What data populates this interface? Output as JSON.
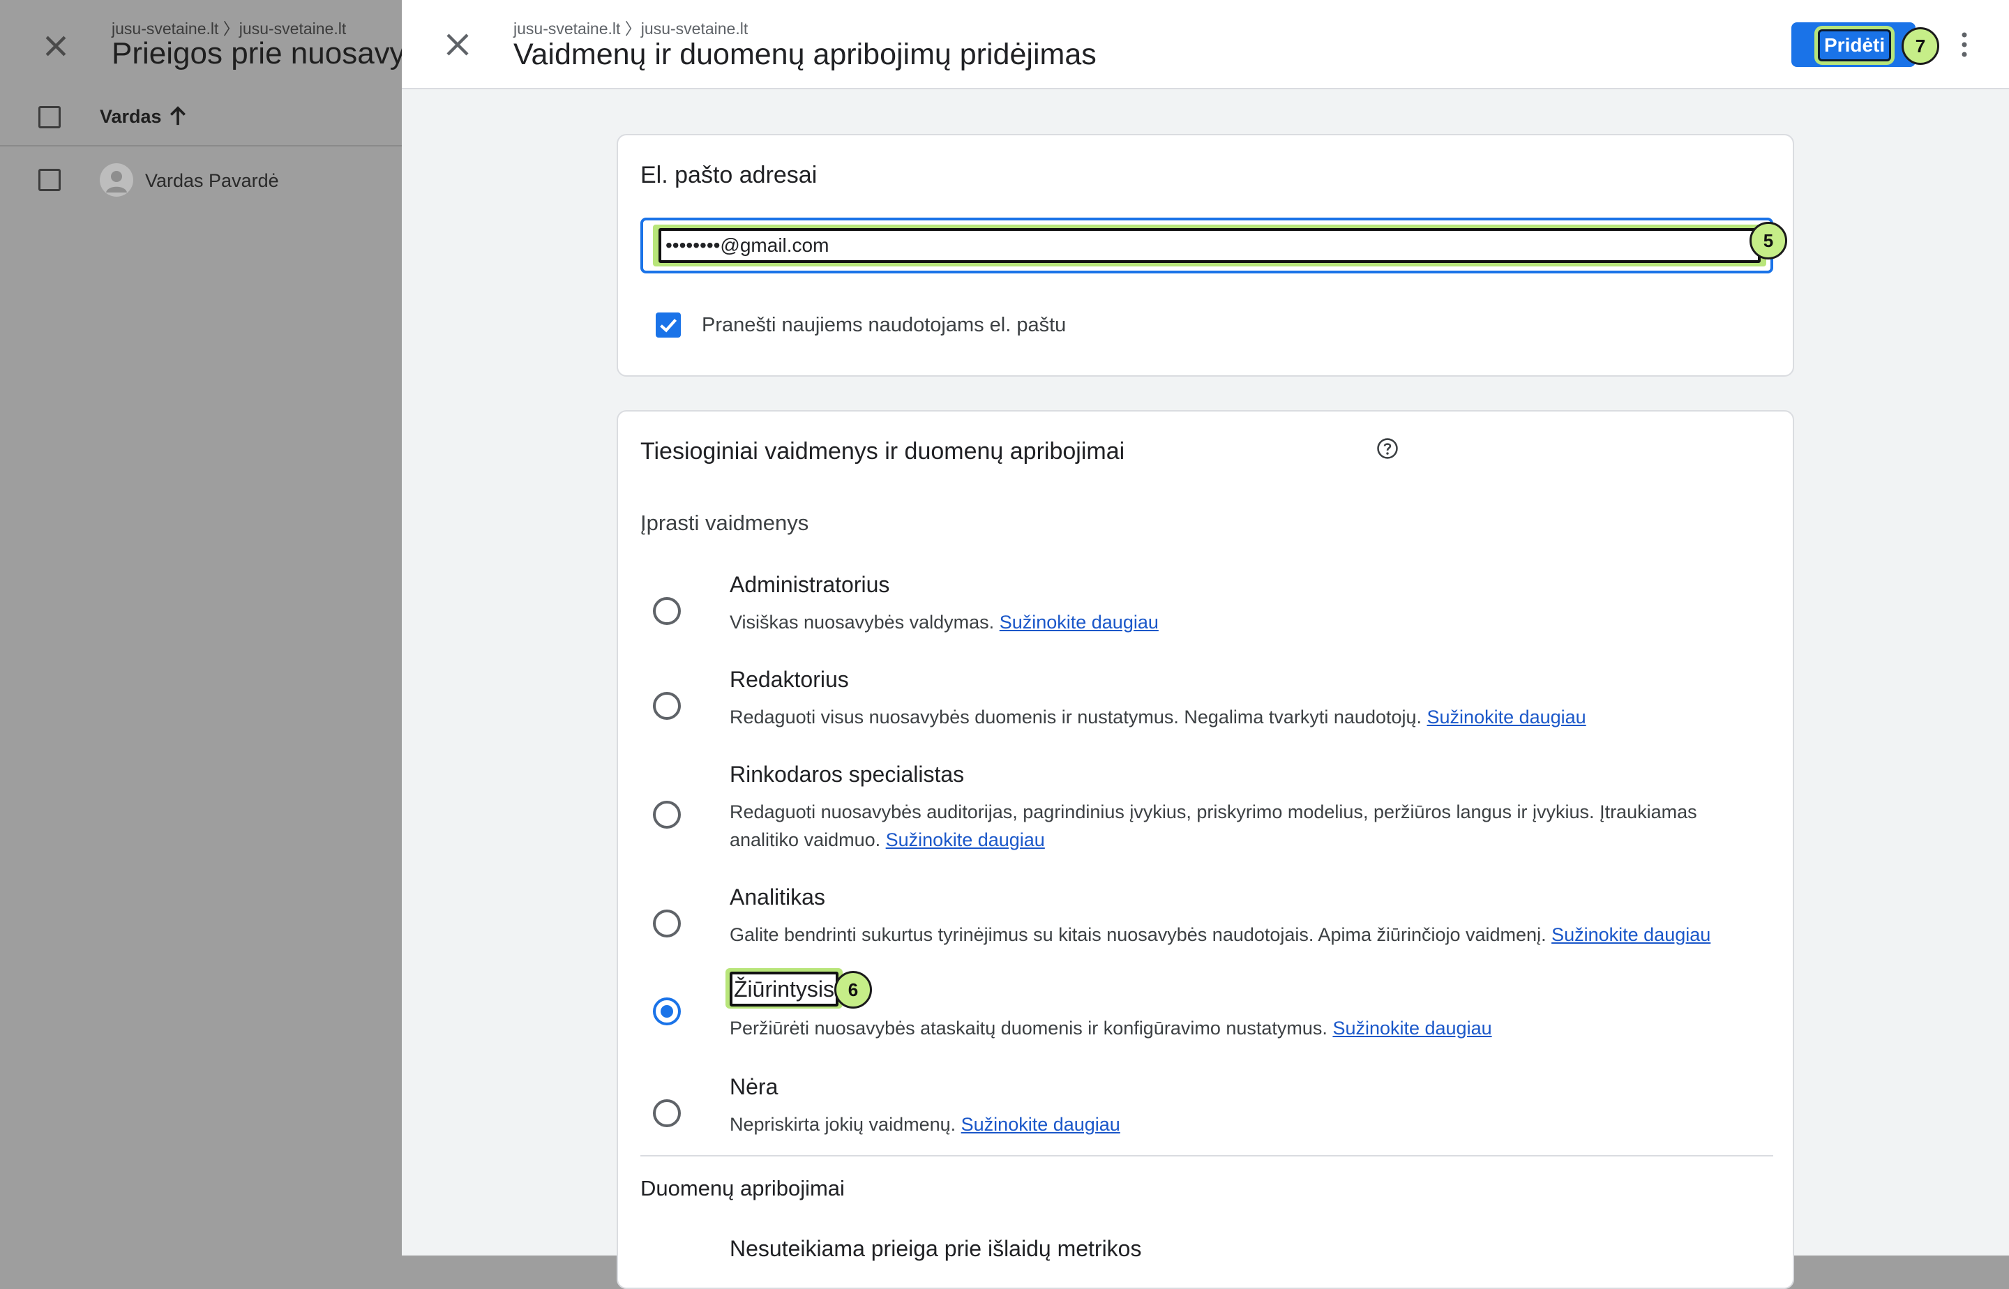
{
  "background": {
    "breadcrumb": "jusu-svetaine.lt 〉jusu-svetaine.lt",
    "title": "Prieigos prie nuosavybės valdymas",
    "column_header": "Vardas",
    "user_name": "Vardas Pavardė"
  },
  "drawer": {
    "breadcrumb": "jusu-svetaine.lt 〉jusu-svetaine.lt",
    "title": "Vaidmenų ir duomenų apribojimų pridėjimas",
    "add_label": "Pridėti",
    "add_step": "7"
  },
  "email_card": {
    "title": "El. pašto adresai",
    "email_value": "••••••••@gmail.com",
    "email_step": "5",
    "notify_label": "Pranešti naujiems naudotojams el. paštu",
    "notify_checked": true
  },
  "roles_card": {
    "title": "Tiesioginiai vaidmenys ir duomenų apribojimai",
    "standard_roles_heading": "Įprasti vaidmenys",
    "learn_more": "Sužinokite daugiau",
    "roles": [
      {
        "name": "Administratorius",
        "desc": "Visiškas nuosavybės valdymas.",
        "checked": false
      },
      {
        "name": "Redaktorius",
        "desc": "Redaguoti visus nuosavybės duomenis ir nustatymus. Negalima tvarkyti naudotojų.",
        "checked": false
      },
      {
        "name": "Rinkodaros specialistas",
        "desc": "Redaguoti nuosavybės auditorijas, pagrindinius įvykius, priskyrimo modelius, peržiūros langus ir įvykius. Įtraukiamas analitiko vaidmuo.",
        "checked": false
      },
      {
        "name": "Analitikas",
        "desc": "Galite bendrinti sukurtus tyrinėjimus su kitais nuosavybės naudotojais. Apima žiūrinčiojo vaidmenį.",
        "checked": false
      },
      {
        "name": "Žiūrintysis",
        "desc": "Peržiūrėti nuosavybės ataskaitų duomenis ir konfigūravimo nustatymus.",
        "checked": true,
        "step": "6"
      },
      {
        "name": "Nėra",
        "desc": "Nepriskirta jokių vaidmenų.",
        "checked": false
      }
    ],
    "data_restrictions_heading": "Duomenų apribojimai",
    "restriction_first": "Nesuteikiama prieiga prie išlaidų metrikos"
  },
  "colors": {
    "accent": "#1a73e8",
    "highlight": "#b8e57a",
    "link": "#1a57c9"
  }
}
